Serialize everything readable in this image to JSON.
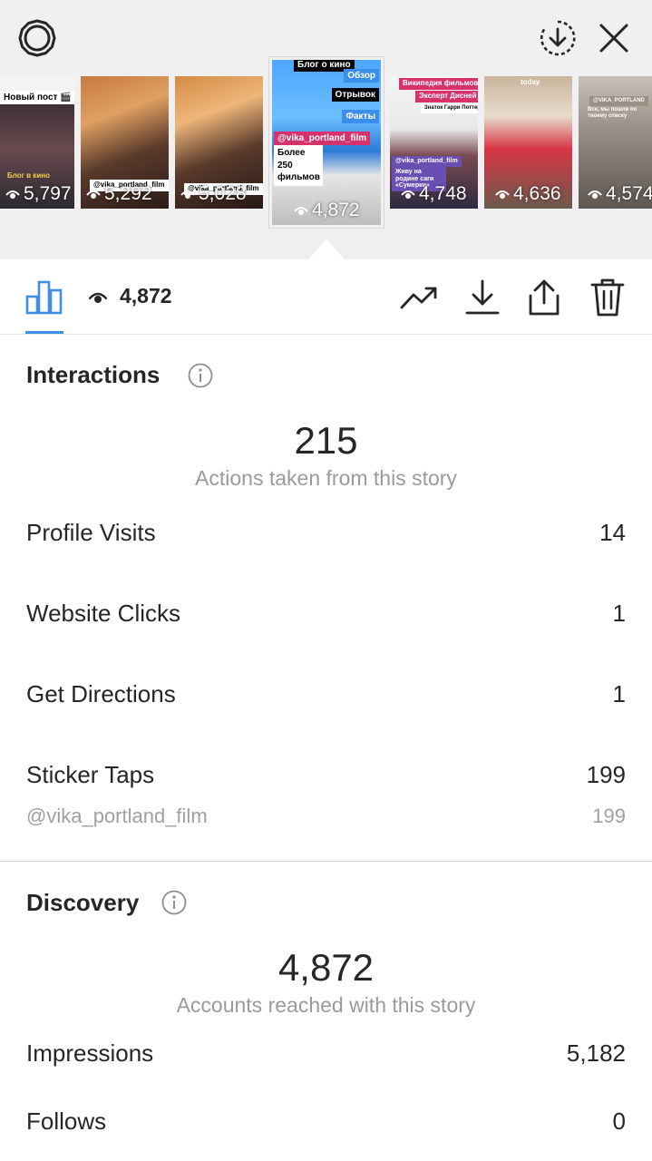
{
  "thumbnails": [
    {
      "views": "5,797",
      "texts": [
        "Новый пост 🎬",
        "Блог в кино"
      ]
    },
    {
      "views": "5,292",
      "texts": [
        "@vika_portland_film"
      ]
    },
    {
      "views": "5,028",
      "texts": [
        "@vika_portland_film"
      ]
    },
    {
      "views": "4,872",
      "texts": [
        "Блог о кино",
        "Обзор",
        "Отрывок",
        "Факты",
        "@vika_portland_film",
        "Более 250 фильмов"
      ]
    },
    {
      "views": "4,748",
      "texts": [
        "Википедия фильмов",
        "Эксперт Дисней",
        "Знаток Гарри Поттера",
        "@vika_portland_film",
        "Живу на родине саги «Сумерки»"
      ]
    },
    {
      "views": "4,636",
      "texts": [
        "today"
      ]
    },
    {
      "views": "4,574",
      "texts": [
        "@VIKA_PORTLAND",
        "Все, мы пошли по твоему списку"
      ]
    }
  ],
  "toolbar": {
    "views": "4,872",
    "icons": [
      "bar-chart-icon",
      "eye-icon",
      "trend-icon",
      "download-icon",
      "share-icon",
      "trash-icon"
    ]
  },
  "interactions": {
    "title": "Interactions",
    "total": "215",
    "total_label": "Actions taken from this story",
    "rows": [
      {
        "label": "Profile Visits",
        "value": "14"
      },
      {
        "label": "Website Clicks",
        "value": "1"
      },
      {
        "label": "Get Directions",
        "value": "1"
      },
      {
        "label": "Sticker Taps",
        "value": "199"
      }
    ],
    "sticker_detail": {
      "label": "@vika_portland_film",
      "value": "199"
    }
  },
  "discovery": {
    "title": "Discovery",
    "total": "4,872",
    "total_label": "Accounts reached with this story",
    "rows": [
      {
        "label": "Impressions",
        "value": "5,182"
      },
      {
        "label": "Follows",
        "value": "0"
      }
    ]
  },
  "colors": {
    "accent": "#3f8ee6",
    "text": "#262626",
    "muted": "#9a9a9a",
    "strip": "#f0f0f0"
  }
}
